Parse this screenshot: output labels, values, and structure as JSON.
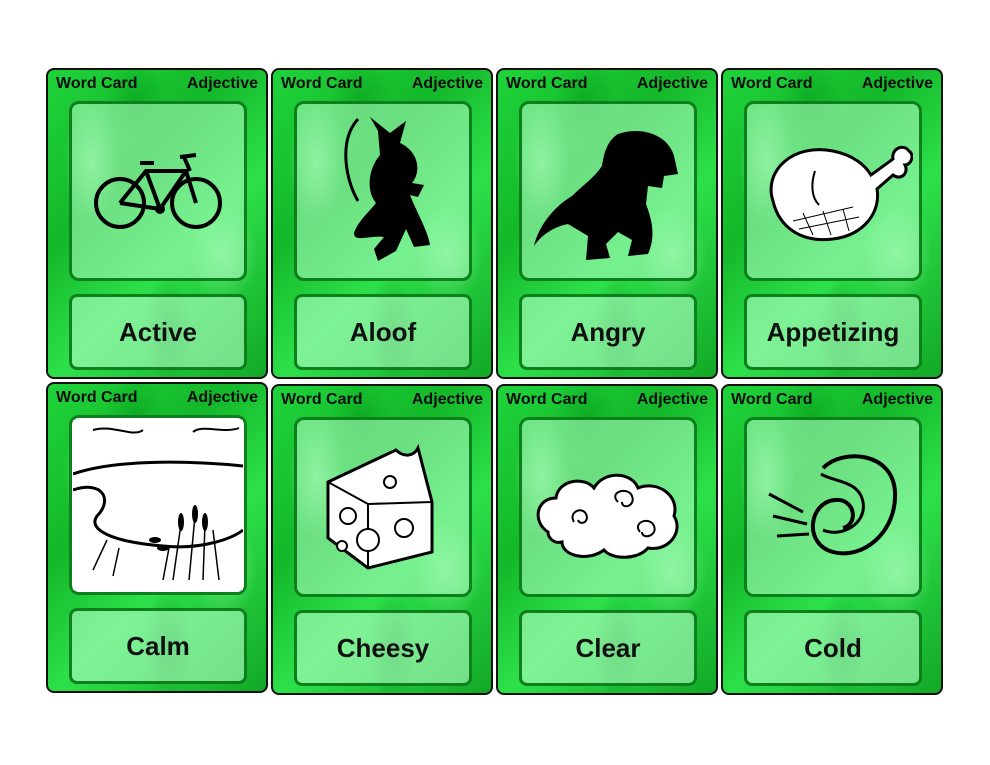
{
  "cards": [
    {
      "header_left": "Word Card",
      "header_right": "Adjective",
      "word": "Active",
      "icon": "bicycle-icon"
    },
    {
      "header_left": "Word Card",
      "header_right": "Adjective",
      "word": "Aloof",
      "icon": "mouse-silhouette-icon"
    },
    {
      "header_left": "Word Card",
      "header_right": "Adjective",
      "word": "Angry",
      "icon": "dinosaur-silhouette-icon"
    },
    {
      "header_left": "Word Card",
      "header_right": "Adjective",
      "word": "Appetizing",
      "icon": "ham-leg-icon"
    },
    {
      "header_left": "Word Card",
      "header_right": "Adjective",
      "word": "Calm",
      "icon": "pond-scene-icon"
    },
    {
      "header_left": "Word Card",
      "header_right": "Adjective",
      "word": "Cheesy",
      "icon": "cheese-wedge-icon"
    },
    {
      "header_left": "Word Card",
      "header_right": "Adjective",
      "word": "Clear",
      "icon": "swirl-clouds-icon"
    },
    {
      "header_left": "Word Card",
      "header_right": "Adjective",
      "word": "Cold",
      "icon": "cold-wind-icon"
    }
  ],
  "colors": {
    "card_green": "#1fd33a",
    "frame_green": "#0d7f1c",
    "panel_tint": "#b4ffc8"
  }
}
